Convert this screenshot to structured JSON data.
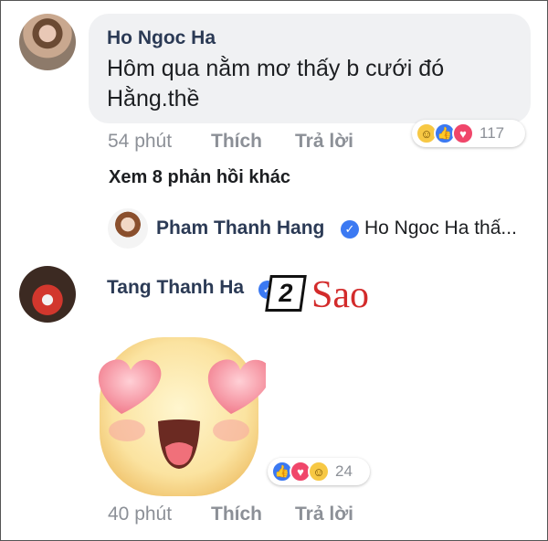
{
  "comments": [
    {
      "author": "Ho Ngoc Ha",
      "text": "Hôm qua nằm mơ thấy b cưới đó Hằng.thề",
      "time": "54 phút",
      "like_label": "Thích",
      "reply_label": "Trả lời",
      "reactions": {
        "icons": [
          "haha-icon",
          "like-icon",
          "love-icon"
        ],
        "count": "117"
      }
    },
    {
      "author": "Tang Thanh Ha",
      "time": "40 phút",
      "like_label": "Thích",
      "reply_label": "Trả lời",
      "sticker": "heart-eyes-sticker",
      "reactions": {
        "icons": [
          "like-icon",
          "love-icon",
          "haha-icon"
        ],
        "count": "24"
      }
    }
  ],
  "more_replies": "Xem 8 phản hồi khác",
  "reply_preview": {
    "author": "Pham Thanh Hang",
    "snippet": "Ho Ngoc Ha thấ..."
  },
  "watermark": {
    "box": "2",
    "text": "Sao"
  },
  "colors": {
    "bubble": "#f0f1f3",
    "name": "#2b3a55",
    "meta": "#8c9097",
    "like": "#3b79f2",
    "love": "#f0466a",
    "haha": "#f7c844",
    "watermark": "#d32b2b"
  }
}
